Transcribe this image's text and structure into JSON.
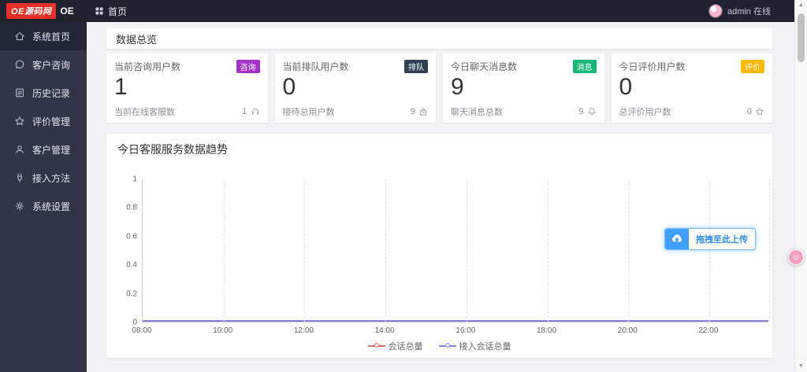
{
  "header": {
    "logo_text": "OE源码网",
    "logo_badge": "OE",
    "breadcrumb": "首页",
    "user_status": "admin 在线"
  },
  "sidebar": {
    "items": [
      {
        "id": "home",
        "label": "系统首页",
        "icon": "home-icon",
        "active": true
      },
      {
        "id": "consult",
        "label": "客户咨询",
        "icon": "chat-icon",
        "active": false
      },
      {
        "id": "history",
        "label": "历史记录",
        "icon": "history-icon",
        "active": false
      },
      {
        "id": "reviews",
        "label": "评价管理",
        "icon": "star-icon",
        "active": false
      },
      {
        "id": "customers",
        "label": "客户管理",
        "icon": "users-icon",
        "active": false
      },
      {
        "id": "access",
        "label": "接入方法",
        "icon": "plug-icon",
        "active": false
      },
      {
        "id": "settings",
        "label": "系统设置",
        "icon": "gear-icon",
        "active": false
      }
    ]
  },
  "overview": {
    "title": "数据总览",
    "cards": [
      {
        "id": "consulting-users",
        "label": "当前咨询用户数",
        "badge": "咨询",
        "badge_color": "#a233c6",
        "value": "1",
        "footer_label": "当前在线客服数",
        "footer_value": "1",
        "footer_icon": "headset-icon"
      },
      {
        "id": "queue-users",
        "label": "当前排队用户数",
        "badge": "排队",
        "badge_color": "#2f4056",
        "value": "0",
        "footer_label": "接待总用户数",
        "footer_value": "9",
        "footer_icon": "building-icon"
      },
      {
        "id": "chat-messages",
        "label": "今日聊天消息数",
        "badge": "消息",
        "badge_color": "#16b777",
        "value": "9",
        "footer_label": "聊天消息总数",
        "footer_value": "9",
        "footer_icon": "bell-icon"
      },
      {
        "id": "review-users",
        "label": "今日评价用户数",
        "badge": "评价",
        "badge_color": "#ffb800",
        "value": "0",
        "footer_label": "总评价用户数",
        "footer_value": "0",
        "footer_icon": "star-icon"
      }
    ]
  },
  "chart": {
    "title": "今日客服服务数据趋势",
    "upload_label": "拖拽至此上传"
  },
  "chart_data": {
    "type": "line",
    "title": "今日客服服务数据趋势",
    "x": [
      "08:00",
      "10:00",
      "12:00",
      "14:00",
      "16:00",
      "18:00",
      "20:00",
      "22:00"
    ],
    "yticks": [
      0,
      0.2,
      0.4,
      0.6,
      0.8,
      1
    ],
    "ylim": [
      0,
      1
    ],
    "grid": "vertical-dashed",
    "legend_position": "bottom",
    "series": [
      {
        "name": "会话总量",
        "color": "#ee6666",
        "values": [
          0,
          0,
          0,
          0,
          0,
          0,
          0,
          0
        ]
      },
      {
        "name": "接入会话总量",
        "color": "#8583e8",
        "values": [
          0,
          0,
          0,
          0,
          0,
          0,
          0,
          0
        ]
      }
    ]
  }
}
